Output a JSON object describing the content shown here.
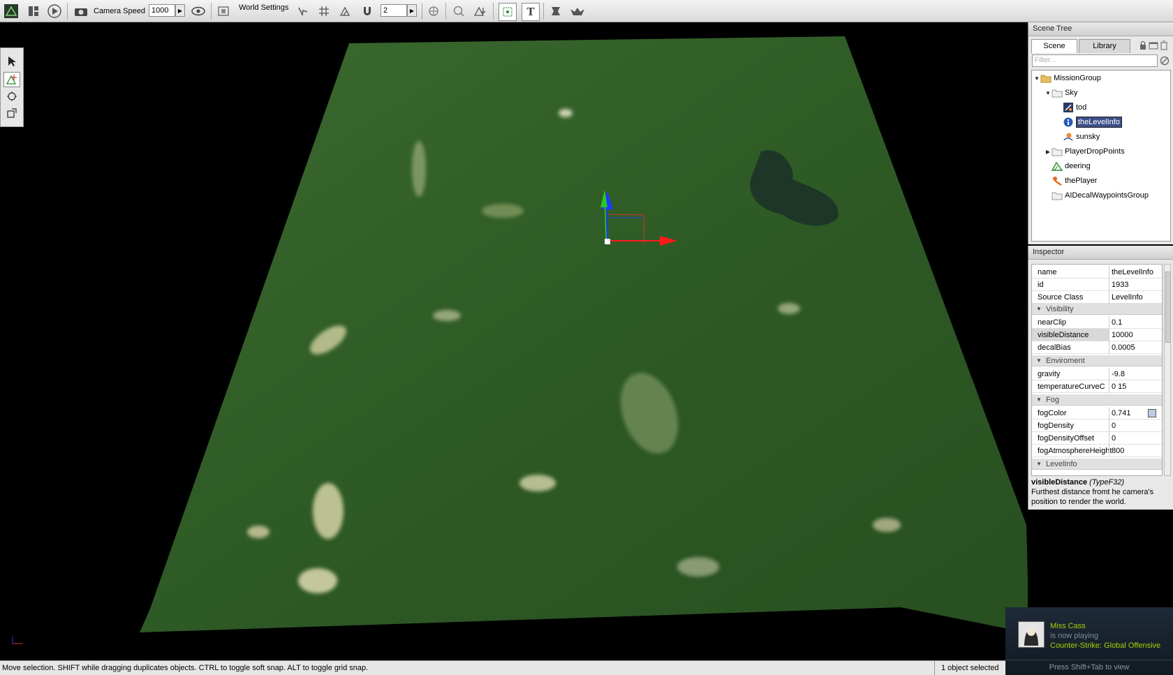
{
  "toolbar": {
    "camera_speed_label": "Camera Speed",
    "camera_speed_value": "1000",
    "world_settings_label": "World Settings",
    "snap_value": "2"
  },
  "scene_tree": {
    "title": "Scene Tree",
    "tabs": [
      "Scene",
      "Library"
    ],
    "active_tab": "Scene",
    "filter_placeholder": "Filter...",
    "items": [
      {
        "label": "MissionGroup",
        "icon": "folder-open-icon",
        "expanded": true
      },
      {
        "label": "Sky",
        "icon": "folder-icon",
        "expanded": true
      },
      {
        "label": "tod",
        "icon": "time-of-day-icon"
      },
      {
        "label": "theLevelInfo",
        "icon": "info-icon",
        "selected": true
      },
      {
        "label": "sunsky",
        "icon": "sun-icon"
      },
      {
        "label": "PlayerDropPoints",
        "icon": "folder-icon",
        "expanded": false
      },
      {
        "label": "deering",
        "icon": "terrain-icon"
      },
      {
        "label": "thePlayer",
        "icon": "player-icon"
      },
      {
        "label": "AIDecalWaypointsGroup",
        "icon": "folder-icon"
      }
    ]
  },
  "inspector": {
    "title": "Inspector",
    "rows": {
      "name": {
        "key": "name",
        "value": "theLevelInfo"
      },
      "id": {
        "key": "id",
        "value": "1933"
      },
      "source_class": {
        "key": "Source Class",
        "value": "LevelInfo"
      },
      "nearclip": {
        "key": "nearClip",
        "value": "0.1"
      },
      "visible_distance": {
        "key": "visibleDistance",
        "value": "10000"
      },
      "decal_bias": {
        "key": "decalBias",
        "value": "0.0005"
      },
      "gravity": {
        "key": "gravity",
        "value": "-9.8"
      },
      "temperature_curve": {
        "key": "temperatureCurveC",
        "value": "0 15"
      },
      "fog_color": {
        "key": "fogColor",
        "value": "0.741"
      },
      "fog_density": {
        "key": "fogDensity",
        "value": "0"
      },
      "fog_density_offset": {
        "key": "fogDensityOffset",
        "value": "0"
      },
      "fog_atmosphere_height": {
        "key": "fogAtmosphereHeight",
        "value": "800"
      }
    },
    "groups": {
      "visibility": "Visibility",
      "environment": "Enviroment",
      "fog": "Fog",
      "levelinfo": "LevelInfo"
    },
    "description_title": "visibleDistance",
    "description_type": "(TypeF32)",
    "description_text": "Furthest distance fromt he camera's position to render the world."
  },
  "status": {
    "hint": "Move selection.  SHIFT while dragging duplicates objects.  CTRL to toggle soft snap.  ALT to toggle grid snap.",
    "selection": "1 object selected"
  },
  "notification": {
    "user": "Miss Cass",
    "status": "is now playing",
    "game": "Counter-Strike: Global Offensive",
    "footer": "Press Shift+Tab to view"
  },
  "colors": {
    "terrain": "#2f5a26",
    "selected": "#3d4f8a",
    "notif_green": "#a4d007"
  }
}
